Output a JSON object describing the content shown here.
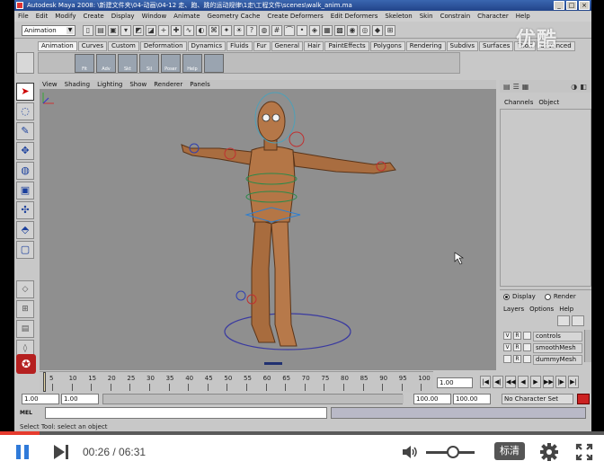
{
  "maya": {
    "title": "Autodesk Maya 2008: \\新建文件夹\\04-动画\\04-12 走、跑、跳的运动规律\\1走\\工程文件\\scenes\\walk_anim.ma",
    "menu": [
      "File",
      "Edit",
      "Modify",
      "Create",
      "Display",
      "Window",
      "Animate",
      "Geometry Cache",
      "Create Deformers",
      "Edit Deformers",
      "Skeleton",
      "Skin",
      "Constrain",
      "Character",
      "Help"
    ],
    "mode": "Animation",
    "shelf_tabs": [
      "Animation",
      "Curves",
      "Custom",
      "Deformation",
      "Dynamics",
      "Fluids",
      "Fur",
      "General",
      "Hair",
      "PaintEffects",
      "Polygons",
      "Rendering",
      "Subdivs",
      "Surfaces",
      "Toon",
      "advanced"
    ],
    "shelf_icons": [
      "Fit",
      "Adv",
      "Skt",
      "Sil",
      "Poser",
      "Help"
    ],
    "panel_menu": [
      "View",
      "Shading",
      "Lighting",
      "Show",
      "Renderer",
      "Panels"
    ],
    "channel_box": {
      "tabs": [
        "Channels",
        "Object"
      ]
    },
    "layer_editor": {
      "radio_display": "Display",
      "radio_render": "Render",
      "menu": [
        "Layers",
        "Options",
        "Help"
      ],
      "layers": [
        {
          "v": "V",
          "r": "R",
          "name": "controls"
        },
        {
          "v": "V",
          "r": "R",
          "name": "smoothMesh"
        },
        {
          "v": "",
          "r": "R",
          "name": "dummyMesh"
        }
      ]
    },
    "timeline": {
      "ticks": [
        "5",
        "10",
        "15",
        "20",
        "25",
        "30",
        "35",
        "40",
        "45",
        "50",
        "55",
        "60",
        "65",
        "70",
        "75",
        "80",
        "85",
        "90",
        "95",
        "100"
      ],
      "current_time": "1.00"
    },
    "range": {
      "start": "1.00",
      "start_inner": "1.00",
      "end_inner": "100.00",
      "end": "100.00",
      "character_set": "No Character Set"
    },
    "command": {
      "label": "MEL"
    },
    "help_line": "Select Tool: select an object",
    "watermark": "优酷"
  },
  "player": {
    "time_current": "00:26",
    "time_separator": " / ",
    "time_total": "06:31",
    "quality": "标清",
    "progress_fraction": 0.066,
    "volume_fraction": 0.55,
    "accent_color": "#2f7ad9",
    "progress_color": "#e63b2e"
  },
  "icons": [
    "pause-icon",
    "next-icon",
    "volume-icon",
    "settings-gear-icon",
    "fullscreen-icon",
    "select-arrow-icon",
    "lasso-icon",
    "move-icon",
    "rotate-icon",
    "scale-icon",
    "maya-logo-icon"
  ]
}
